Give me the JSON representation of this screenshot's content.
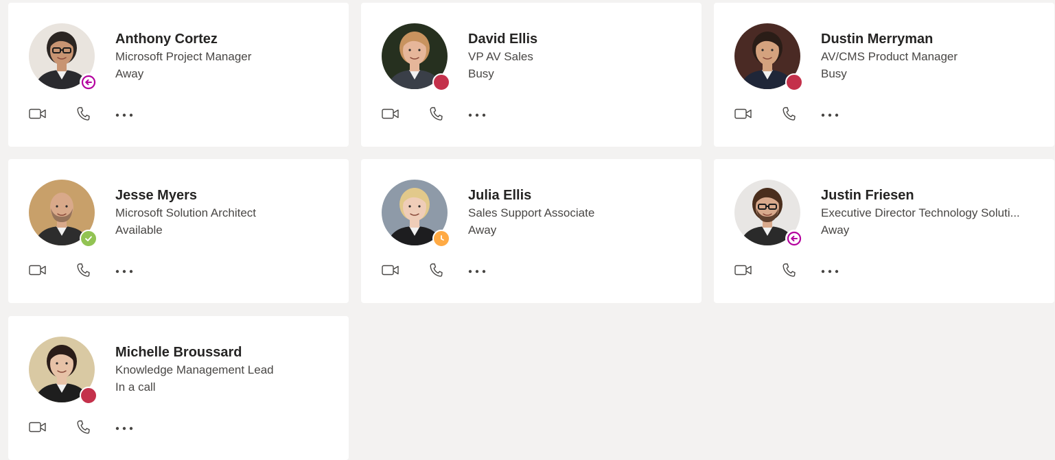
{
  "contacts": [
    {
      "name": "Anthony Cortez",
      "title": "Microsoft Project Manager",
      "presence": "Away",
      "status": "ooo",
      "avatar": {
        "bg": "#e9e4de",
        "skin": "#c89472",
        "hair": "#2b2522",
        "shirt": "#2a2a2e",
        "glasses": true,
        "beard": false
      }
    },
    {
      "name": "David Ellis",
      "title": "VP AV Sales",
      "presence": "Busy",
      "status": "busy",
      "avatar": {
        "bg": "#26301f",
        "skin": "#e6b69a",
        "hair": "#c8935f",
        "shirt": "#3a3f48",
        "glasses": false,
        "beard": false
      }
    },
    {
      "name": "Dustin Merryman",
      "title": "AV/CMS Product Manager",
      "presence": "Busy",
      "status": "busy",
      "avatar": {
        "bg": "#4a2a24",
        "skin": "#d4a27e",
        "hair": "#2a1d17",
        "shirt": "#1f2638",
        "glasses": false,
        "beard": false
      }
    },
    {
      "name": "Jesse Myers",
      "title": "Microsoft Solution Architect",
      "presence": "Available",
      "status": "available",
      "avatar": {
        "bg": "#c8a06a",
        "skin": "#d9a98a",
        "hair": "#d9a98a",
        "shirt": "#2d2d2d",
        "glasses": false,
        "beard": true
      }
    },
    {
      "name": "Julia Ellis",
      "title": "Sales Support Associate",
      "presence": "Away",
      "status": "away",
      "avatar": {
        "bg": "#8e9aa8",
        "skin": "#efcdb8",
        "hair": "#e2c98b",
        "shirt": "#1d1d1f",
        "glasses": false,
        "beard": false
      }
    },
    {
      "name": "Justin Friesen",
      "title": "Executive Director Technology Soluti...",
      "presence": "Away",
      "status": "ooo",
      "avatar": {
        "bg": "#e8e6e4",
        "skin": "#d8a98c",
        "hair": "#4a2e1d",
        "shirt": "#2a2a2a",
        "glasses": true,
        "beard": true
      }
    },
    {
      "name": "Michelle Broussard",
      "title": "Knowledge Management Lead",
      "presence": "In a call",
      "status": "busy",
      "avatar": {
        "bg": "#d9c9a3",
        "skin": "#e7c2a7",
        "hair": "#2a1c18",
        "shirt": "#1e1e1e",
        "glasses": false,
        "beard": false
      }
    }
  ],
  "colors": {
    "background": "#f3f2f1",
    "card": "#ffffff",
    "busy": "#c4314b",
    "available": "#92c353",
    "away": "#ffaa44",
    "out_of_office": "#b4009e",
    "icon": "#484644"
  },
  "icons": {
    "video": "video-camera-icon",
    "call": "phone-icon",
    "more": "more-options-icon"
  }
}
